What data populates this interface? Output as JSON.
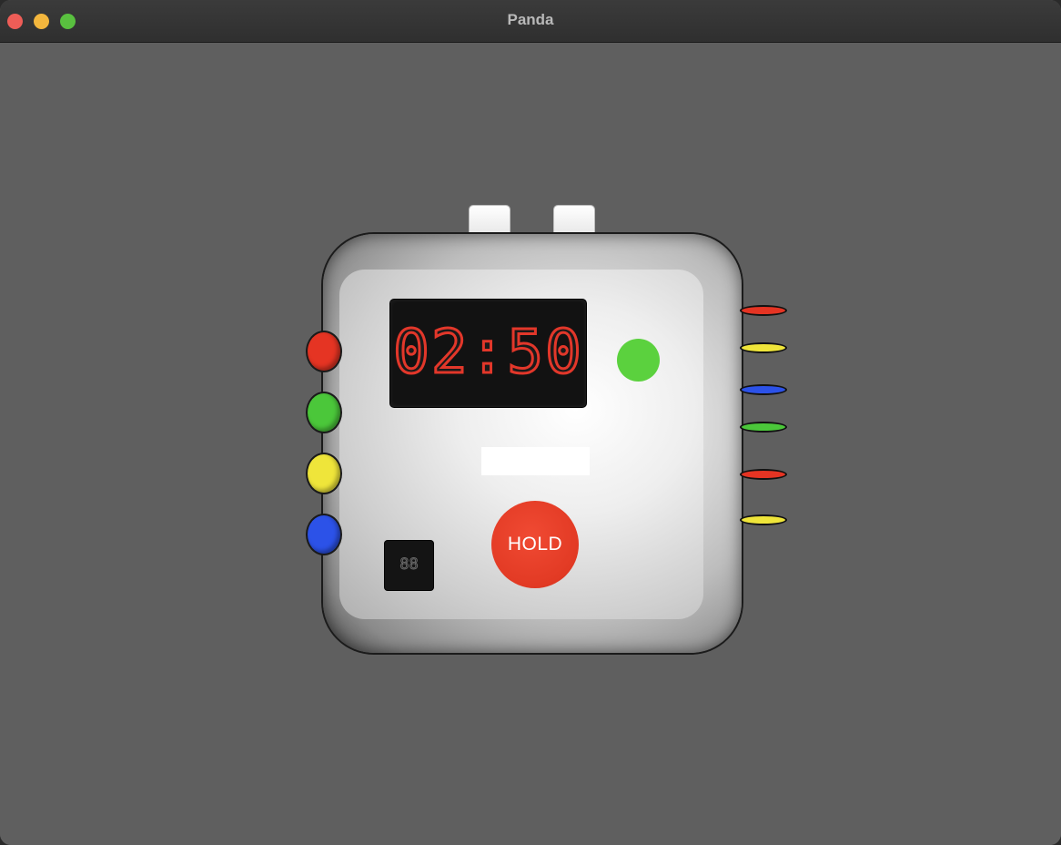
{
  "window": {
    "title": "Panda"
  },
  "bomb": {
    "timer": "02:50",
    "strikes": "88",
    "hold_label": "HOLD",
    "status_led_color": "#5bd13e",
    "label_strip_text": "",
    "side_buttons": [
      {
        "name": "side-button-red",
        "color": "#e53423"
      },
      {
        "name": "side-button-green",
        "color": "#4bc73a"
      },
      {
        "name": "side-button-yellow",
        "color": "#efe53a"
      },
      {
        "name": "side-button-blue",
        "color": "#2c52e8"
      }
    ],
    "wires": [
      {
        "name": "wire-red-1",
        "color": "#e53423"
      },
      {
        "name": "wire-yellow-1",
        "color": "#efe53a"
      },
      {
        "name": "wire-blue",
        "color": "#2c52e8"
      },
      {
        "name": "wire-green",
        "color": "#4bc73a"
      },
      {
        "name": "wire-red-2",
        "color": "#e53423"
      },
      {
        "name": "wire-yellow-2",
        "color": "#efe53a"
      }
    ]
  }
}
